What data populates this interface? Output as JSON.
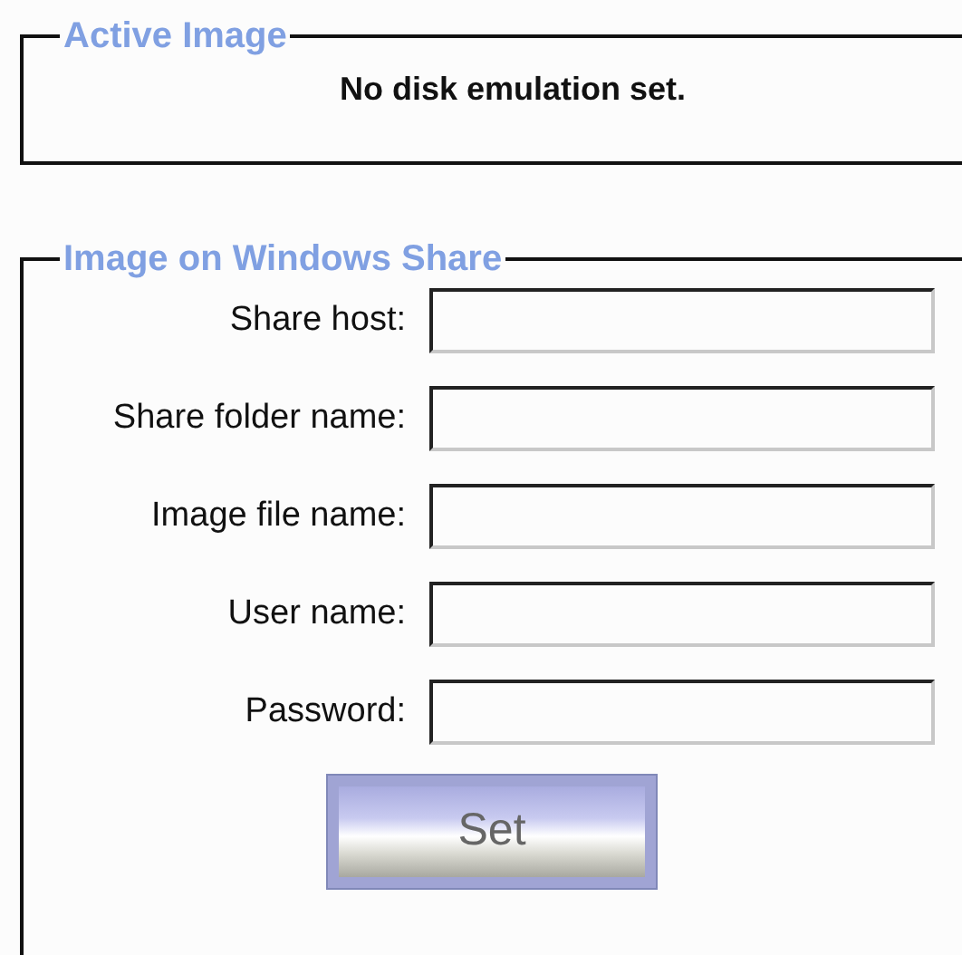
{
  "active_image": {
    "title": "Active Image",
    "status": "No disk emulation set."
  },
  "windows_share": {
    "title": "Image on Windows Share",
    "fields": [
      {
        "label": "Share host:"
      },
      {
        "label": "Share folder name:"
      },
      {
        "label": "Image file name:"
      },
      {
        "label": "User name:"
      },
      {
        "label": "Password:"
      }
    ],
    "button": "Set"
  }
}
